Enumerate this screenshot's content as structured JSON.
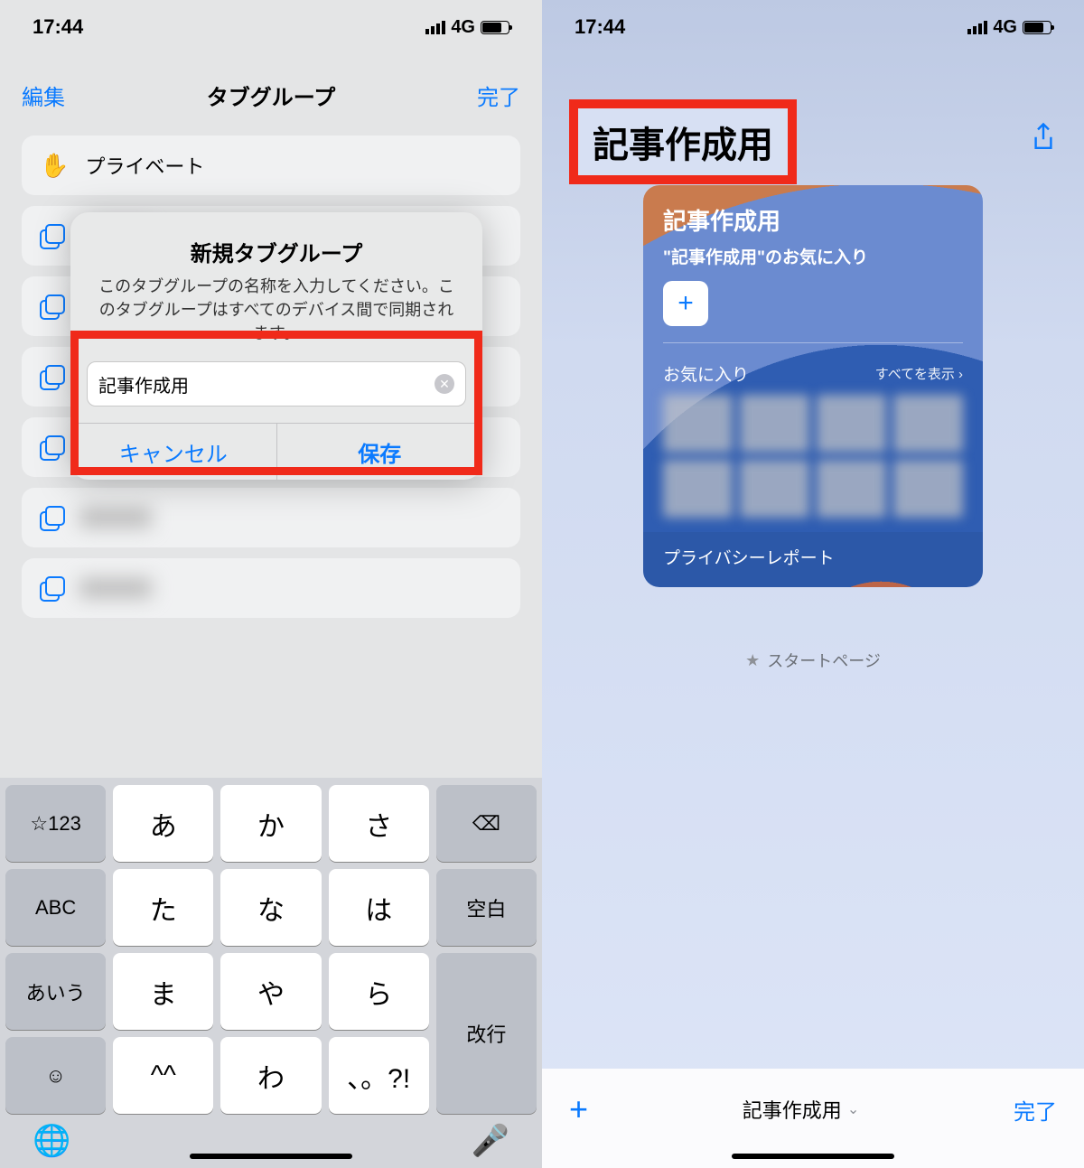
{
  "status": {
    "time": "17:44",
    "network": "4G"
  },
  "left": {
    "nav": {
      "edit": "編集",
      "title": "タブグループ",
      "done": "完了"
    },
    "private_label": "プライベート",
    "alert": {
      "title": "新規タブグループ",
      "message": "このタブグループの名称を入力してください。このタブグループはすべてのデバイス間で同期されます。",
      "input_value": "記事作成用",
      "cancel": "キャンセル",
      "save": "保存"
    },
    "keyboard": {
      "row1": [
        "☆123",
        "あ",
        "か",
        "さ",
        "⌫"
      ],
      "row2": [
        "ABC",
        "た",
        "な",
        "は",
        "空白"
      ],
      "row3_left": "あいう",
      "row3_mid": [
        "ま",
        "や",
        "ら"
      ],
      "row3_right": "改行",
      "row4": [
        "☺",
        "^^",
        "わ",
        "、。?!"
      ]
    }
  },
  "right": {
    "title": "記事作成用",
    "card": {
      "heading": "記事作成用",
      "sub": "\"記事作成用\"のお気に入り",
      "fav_label": "お気に入り",
      "show_all": "すべてを表示",
      "footer": "プライバシーレポート"
    },
    "caption": "スタートページ",
    "bottombar": {
      "group": "記事作成用",
      "done": "完了"
    }
  }
}
